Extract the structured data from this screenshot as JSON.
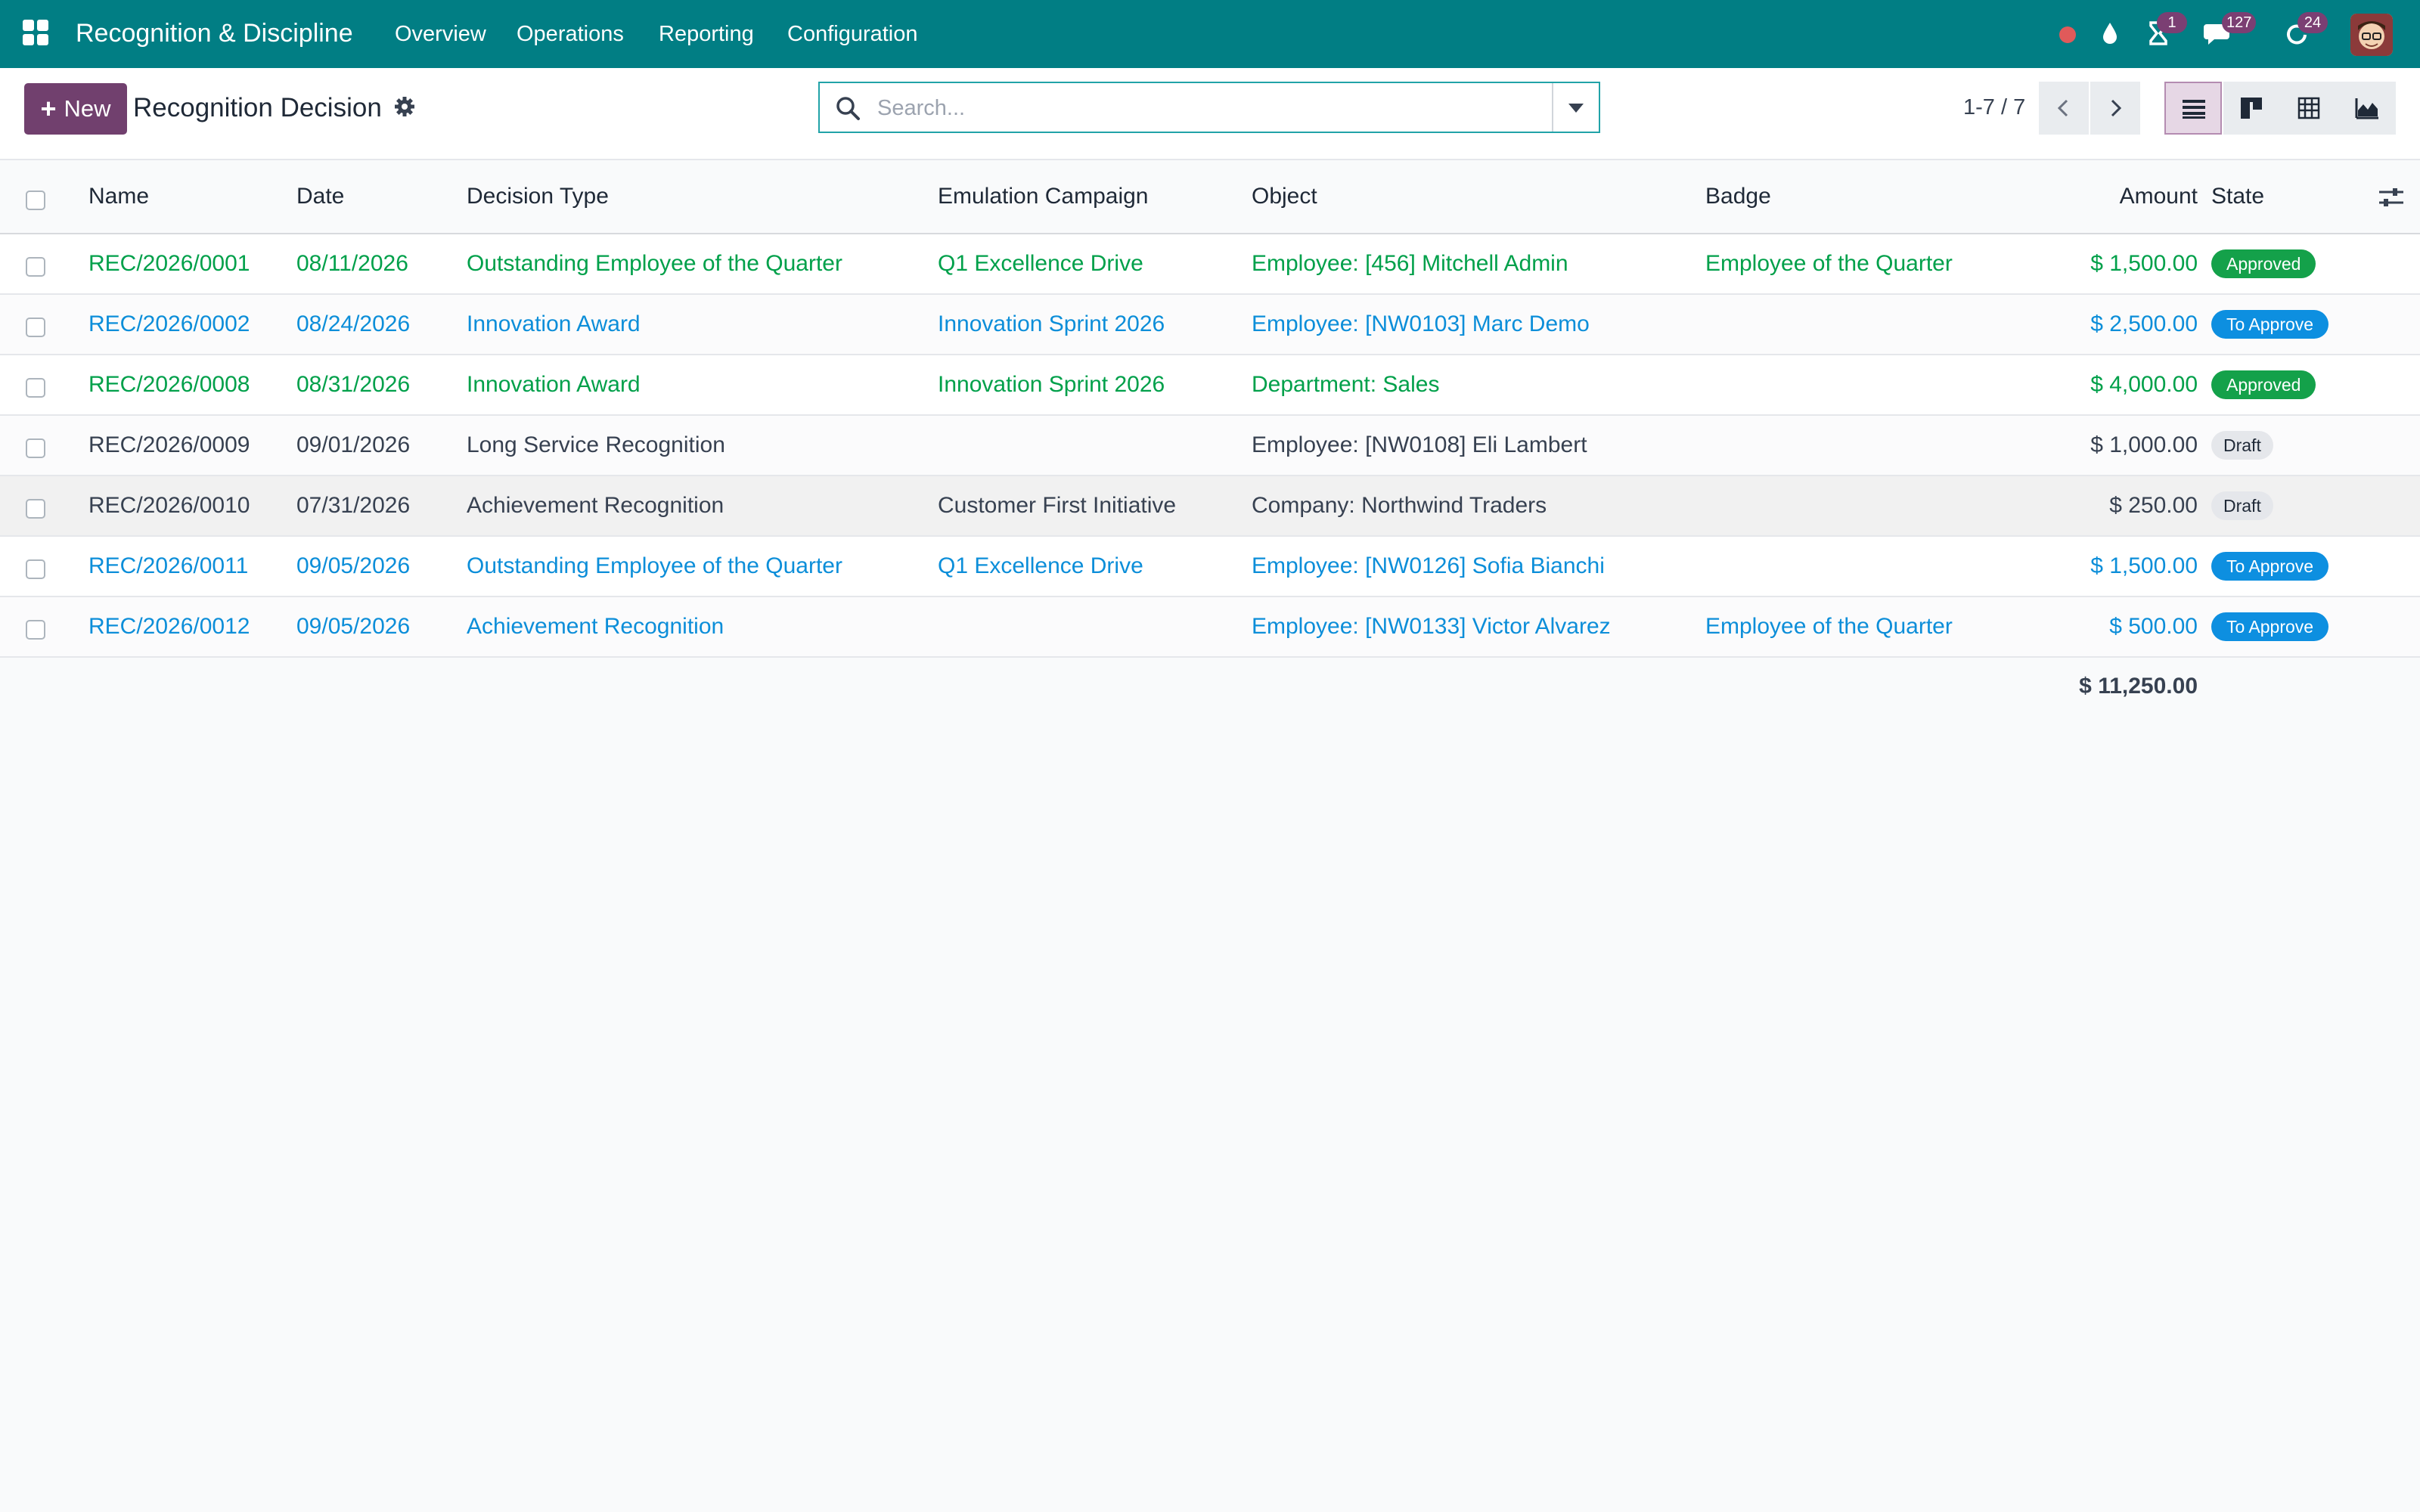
{
  "navbar": {
    "app_title": "Recognition & Discipline",
    "menu": [
      "Overview",
      "Operations",
      "Reporting",
      "Configuration"
    ],
    "activity_count": "1",
    "messages_count": "127",
    "updates_count": "24"
  },
  "control_panel": {
    "new_label": "New",
    "title": "Recognition Decision",
    "search_placeholder": "Search...",
    "pager": "1-7 / 7"
  },
  "table": {
    "headers": {
      "name": "Name",
      "date": "Date",
      "decision_type": "Decision Type",
      "campaign": "Emulation Campaign",
      "object": "Object",
      "badge": "Badge",
      "amount": "Amount",
      "state": "State"
    },
    "rows": [
      {
        "name": "REC/2026/0001",
        "date": "08/11/2026",
        "decision_type": "Outstanding Employee of the Quarter",
        "campaign": "Q1 Excellence Drive",
        "object": "Employee: [456] Mitchell Admin",
        "badge": "Employee of the Quarter",
        "amount": "$ 1,500.00",
        "state": "Approved"
      },
      {
        "name": "REC/2026/0002",
        "date": "08/24/2026",
        "decision_type": "Innovation Award",
        "campaign": "Innovation Sprint 2026",
        "object": "Employee: [NW0103] Marc Demo",
        "badge": "",
        "amount": "$ 2,500.00",
        "state": "To Approve"
      },
      {
        "name": "REC/2026/0008",
        "date": "08/31/2026",
        "decision_type": "Innovation Award",
        "campaign": "Innovation Sprint 2026",
        "object": "Department: Sales",
        "badge": "",
        "amount": "$ 4,000.00",
        "state": "Approved"
      },
      {
        "name": "REC/2026/0009",
        "date": "09/01/2026",
        "decision_type": "Long Service Recognition",
        "campaign": "",
        "object": "Employee: [NW0108] Eli Lambert",
        "badge": "",
        "amount": "$ 1,000.00",
        "state": "Draft"
      },
      {
        "name": "REC/2026/0010",
        "date": "07/31/2026",
        "decision_type": "Achievement Recognition",
        "campaign": "Customer First Initiative",
        "object": "Company: Northwind Traders",
        "badge": "",
        "amount": "$ 250.00",
        "state": "Draft"
      },
      {
        "name": "REC/2026/0011",
        "date": "09/05/2026",
        "decision_type": "Outstanding Employee of the Quarter",
        "campaign": "Q1 Excellence Drive",
        "object": "Employee: [NW0126] Sofia Bianchi",
        "badge": "",
        "amount": "$ 1,500.00",
        "state": "To Approve"
      },
      {
        "name": "REC/2026/0012",
        "date": "09/05/2026",
        "decision_type": "Achievement Recognition",
        "campaign": "",
        "object": "Employee: [NW0133] Victor Alvarez",
        "badge": "Employee of the Quarter",
        "amount": "$ 500.00",
        "state": "To Approve"
      }
    ],
    "total_amount": "$ 11,250.00"
  },
  "colors": {
    "navbar": "#017e84",
    "primary": "#71406e",
    "approved_text": "#00a04a",
    "to_approve_text": "#0c8ed9"
  }
}
